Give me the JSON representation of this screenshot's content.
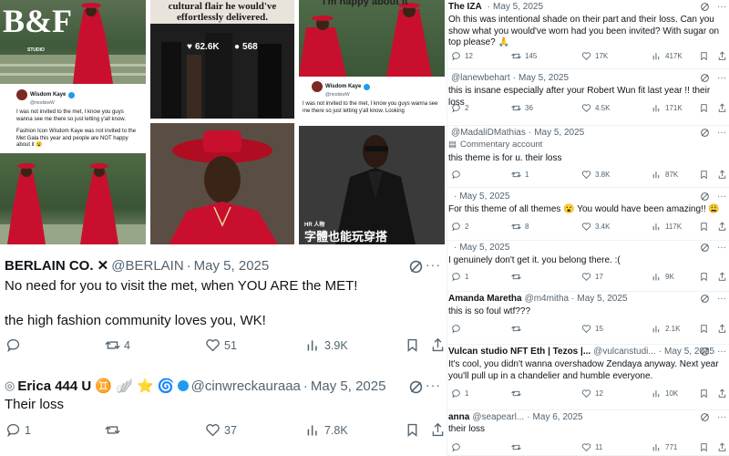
{
  "collage": {
    "brand_logo": "B&F",
    "brand_sub": "STUDIO",
    "headline_fragment": "cultural flair he would've effortlessly delivered.",
    "likes": "62.6K",
    "comments": "568",
    "top_right_fragment": "I'm happy about it",
    "chinese_watermark": "字體也能玩穿搭",
    "hr_tag": "HR 人物",
    "mini_post_1": {
      "name": "Wisdom Kaye",
      "handle": "@modsiwW",
      "text": "I was not invited to the met, I know you guys wanna see me there so just letting y'all know."
    },
    "mini_post_2": {
      "name": "Wisdom Kaye",
      "handle": "@modsiwW",
      "text": "I was not invited to the met, I know you guys wanna see me there so just letting y'all know. Looking"
    },
    "caption_block": "Fashion Icon Wisdom Kaye was not invited to the Met Gala this year and people are NOT happy about it 😮"
  },
  "left_tweets": [
    {
      "name": "BERLAIN CO. ✕",
      "handle": "@BERLAIN",
      "date": "May 5, 2025",
      "text_lines": [
        "No need for you to visit the met, when YOU ARE the MET!",
        "",
        "the high fashion community loves you, WK!"
      ],
      "replies": "",
      "retweets": "4",
      "likes": "51",
      "views": "3.9K"
    },
    {
      "name": "Erica 444 U ♊ 🪽 ⭐ 🌀",
      "handle": "@cinwreckauraaa",
      "date": "May 5, 2025",
      "text_lines": [
        "Their loss"
      ],
      "replies": "1",
      "retweets": "",
      "likes": "37",
      "views": "7.8K"
    }
  ],
  "right_tweets": [
    {
      "name": "The IZA",
      "handle": "",
      "date": "May 5, 2025",
      "community": "",
      "text": "Oh this was intentional shade on their part and their loss. Can you show what you would've worn had you been invited? With sugar on top please? 🙏",
      "replies": "12",
      "retweets": "145",
      "likes": "17K",
      "views": "417K"
    },
    {
      "name": "",
      "handle": "@lanewbehart",
      "date": "May 5, 2025",
      "community": "",
      "text": "this is insane especially after your Robert Wun fit last year !! their loss",
      "replies": "2",
      "retweets": "36",
      "likes": "4.5K",
      "views": "171K"
    },
    {
      "name": "",
      "handle": "@MadaliDMathias",
      "date": "May 5, 2025",
      "community": "Commentary account",
      "text": "this theme is for u. their loss",
      "replies": "",
      "retweets": "1",
      "likes": "3.8K",
      "views": "87K"
    },
    {
      "name": "",
      "handle": "",
      "date": "May 5, 2025",
      "community": "",
      "text": "For this theme of all themes 😮 You would have been amazing!! 😩",
      "replies": "2",
      "retweets": "8",
      "likes": "3.4K",
      "views": "117K"
    },
    {
      "name": "",
      "handle": "",
      "date": "May 5, 2025",
      "community": "",
      "text": "I genuinely don't get it. you belong there. :(",
      "replies": "1",
      "retweets": "",
      "likes": "17",
      "views": "9K"
    },
    {
      "name": "Amanda Maretha",
      "handle": "@m4mitha",
      "date": "May 5, 2025",
      "community": "",
      "text": "this is so foul wtf???",
      "replies": "",
      "retweets": "",
      "likes": "15",
      "views": "2.1K"
    },
    {
      "name": "Vulcan studio NFT Eth | Tezos |...",
      "handle": "@vulcanstudi...",
      "date": "May 5, 2025",
      "community": "",
      "text": "It's cool, you didn't wanna overshadow Zendaya anyway. Next year you'll pull up in a chandelier and humble everyone.",
      "replies": "1",
      "retweets": "",
      "likes": "12",
      "views": "10K"
    },
    {
      "name": "anna",
      "handle": "@seapearl...",
      "date": "May 6, 2025",
      "community": "",
      "text": "their loss",
      "replies": "",
      "retweets": "",
      "likes": "11",
      "views": "771"
    }
  ],
  "colors": {
    "text": "#0f1419",
    "muted": "#536471",
    "verified": "#1d9bf0",
    "red_outfit": "#c8102e"
  }
}
